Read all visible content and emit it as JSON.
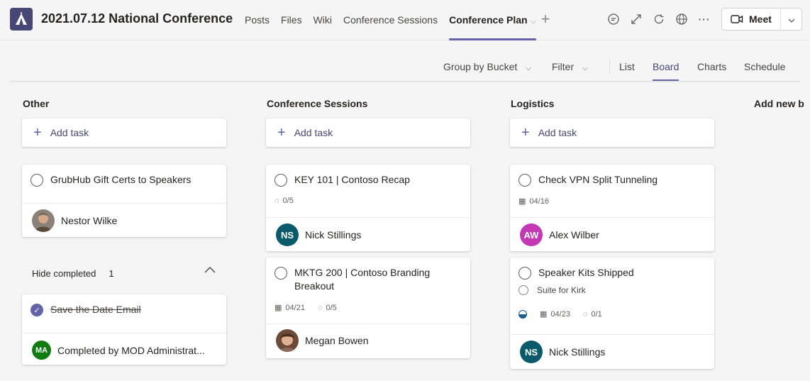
{
  "header": {
    "team_title": "2021.07.12 National Conference",
    "tabs": [
      {
        "label": "Posts",
        "active": false
      },
      {
        "label": "Files",
        "active": false
      },
      {
        "label": "Wiki",
        "active": false
      },
      {
        "label": "Conference Sessions",
        "active": false
      },
      {
        "label": "Conference Plan",
        "active": true
      }
    ],
    "add_tab": "+",
    "meet_label": "Meet",
    "icons": [
      "chat-icon",
      "expand-icon",
      "refresh-icon",
      "globe-icon",
      "more-icon"
    ],
    "more_label": "···"
  },
  "toolbar": {
    "group_by": "Group by Bucket",
    "filter": "Filter",
    "views": [
      {
        "label": "List",
        "active": false
      },
      {
        "label": "Board",
        "active": true
      },
      {
        "label": "Charts",
        "active": false
      },
      {
        "label": "Schedule",
        "active": false
      }
    ]
  },
  "board": {
    "add_task_label": "Add task",
    "add_bucket_label": "Add new b",
    "buckets": [
      {
        "name": "Other",
        "tasks": [
          {
            "title": "GrubHub Gift Certs to Speakers",
            "assignee": "Nestor Wilke"
          }
        ],
        "hide_completed_label": "Hide completed",
        "completed_count": "1",
        "completed_tasks": [
          {
            "title": "Save the Date Email",
            "completed_by": "Completed by MOD Administrat...",
            "initials": "MA"
          }
        ]
      },
      {
        "name": "Conference Sessions",
        "tasks": [
          {
            "title": "KEY 101 | Contoso Recap",
            "checklist": "0/5",
            "assignee": "Nick Stillings",
            "initials": "NS"
          },
          {
            "title": "MKTG 200 | Contoso Branding Breakout",
            "due": "04/21",
            "checklist": "0/5",
            "assignee": "Megan Bowen"
          }
        ]
      },
      {
        "name": "Logistics",
        "tasks": [
          {
            "title": "Check VPN Split Tunneling",
            "due": "04/16",
            "assignee": "Alex Wilber",
            "initials": "AW"
          },
          {
            "title": "Speaker Kits Shipped",
            "checklist_item": "Suite for Kirk",
            "progress": 0.5,
            "due": "04/23",
            "checklist": "0/1",
            "assignee": "Nick Stillings",
            "initials": "NS"
          }
        ]
      }
    ]
  },
  "colors": {
    "brand": "#6264a7",
    "brand_dark": "#464775",
    "avatar_ns": "#0b5a6b",
    "avatar_aw": "#c239b3",
    "avatar_ma": "#107c10"
  }
}
